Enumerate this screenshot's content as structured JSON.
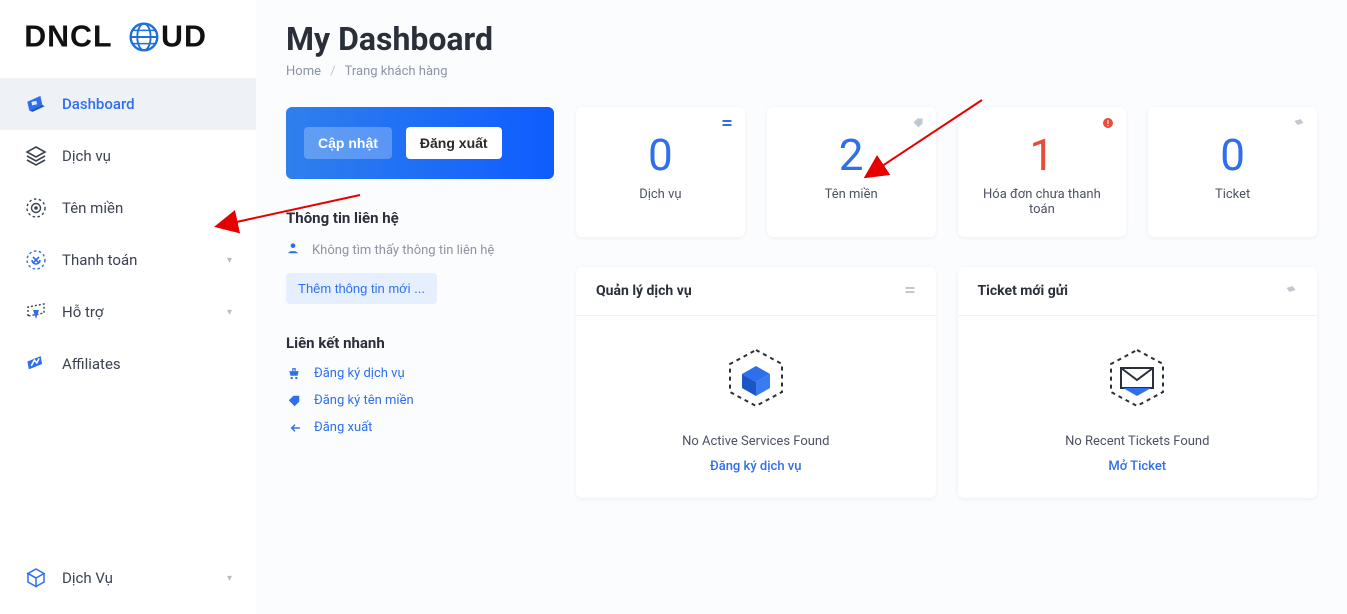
{
  "brand": {
    "name": "DNCLOUD"
  },
  "nav": {
    "items": [
      {
        "label": "Dashboard",
        "active": true
      },
      {
        "label": "Dịch vụ"
      },
      {
        "label": "Tên miền"
      },
      {
        "label": "Thanh toán",
        "expandable": true
      },
      {
        "label": "Hỗ trợ",
        "expandable": true
      },
      {
        "label": "Affiliates"
      }
    ],
    "bottom": {
      "label": "Dịch Vụ",
      "expandable": true
    }
  },
  "header": {
    "title": "My Dashboard",
    "breadcrumb": {
      "root": "Home",
      "current": "Trang khách hàng"
    }
  },
  "action_card": {
    "update_label": "Cập nhật",
    "logout_label": "Đăng xuất"
  },
  "contact": {
    "section_title": "Thông tin liên hệ",
    "empty_msg": "Không tìm thấy thông tin liên hệ",
    "add_btn": "Thêm thông tin mới ..."
  },
  "quick": {
    "section_title": "Liên kết nhanh",
    "links": [
      {
        "label": "Đăng ký dịch vụ"
      },
      {
        "label": "Đăng ký tên miền"
      },
      {
        "label": "Đăng xuất"
      }
    ]
  },
  "stats": [
    {
      "value": "0",
      "label": "Dịch vụ",
      "color": "blue",
      "badge_color": "#2f6fed"
    },
    {
      "value": "2",
      "label": "Tên miền",
      "color": "blue",
      "badge_color": "#c2c8d0"
    },
    {
      "value": "1",
      "label": "Hóa đơn chưa thanh toán",
      "color": "red",
      "badge_color": "#e74c3c"
    },
    {
      "value": "0",
      "label": "Ticket",
      "color": "blue",
      "badge_color": "#c2c8d0"
    }
  ],
  "panels": {
    "services": {
      "title": "Quản lý dịch vụ",
      "empty_msg": "No Active Services Found",
      "link_label": "Đăng ký dịch vụ"
    },
    "tickets": {
      "title": "Ticket mới gửi",
      "empty_msg": "No Recent Tickets Found",
      "link_label": "Mở Ticket"
    }
  }
}
